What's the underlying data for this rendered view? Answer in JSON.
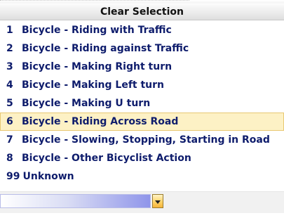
{
  "header": {
    "clear_selection_label": "Clear Selection"
  },
  "list": {
    "items": [
      {
        "code": "1",
        "label": "Bicycle - Riding with Traffic",
        "selected": false
      },
      {
        "code": "2",
        "label": "Bicycle - Riding against Traffic",
        "selected": false
      },
      {
        "code": "3",
        "label": "Bicycle - Making Right turn",
        "selected": false
      },
      {
        "code": "4",
        "label": "Bicycle - Making Left turn",
        "selected": false
      },
      {
        "code": "5",
        "label": "Bicycle - Making U turn",
        "selected": false
      },
      {
        "code": "6",
        "label": "Bicycle - Riding Across Road",
        "selected": true
      },
      {
        "code": "7",
        "label": "Bicycle - Slowing, Stopping, Starting in Road",
        "selected": false
      },
      {
        "code": "8",
        "label": "Bicycle - Other Bicyclist Action",
        "selected": false
      },
      {
        "code": "99",
        "label": "Unknown",
        "selected": false
      }
    ]
  },
  "dropdown": {
    "value": "",
    "icon": "chevron-down-icon"
  },
  "colors": {
    "item_text": "#0e1c6c",
    "selected_bg": "#fdf1c5",
    "selected_border": "#e8c873",
    "dropdown_button": "#ffd56a"
  }
}
